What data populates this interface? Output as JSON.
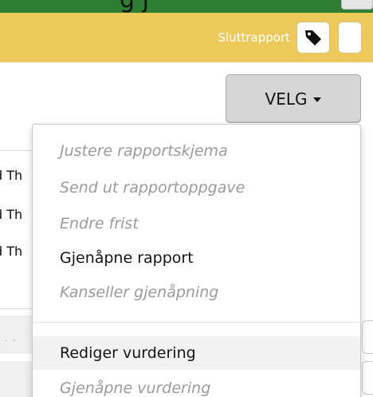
{
  "banner": {
    "text": "g          j"
  },
  "status_bar": {
    "label": "Sluttrapport",
    "tag_icon": "tag-icon"
  },
  "action_button": {
    "label": "VELG"
  },
  "background_rows": [
    "d Th",
    "d Th",
    "d Th"
  ],
  "background_dots": ". .",
  "menu": {
    "items": [
      {
        "label": "Justere rapportskjema",
        "enabled": false
      },
      {
        "label": "Send ut rapportoppgave",
        "enabled": false
      },
      {
        "label": "Endre frist",
        "enabled": false
      },
      {
        "label": "Gjenåpne rapport",
        "enabled": true
      },
      {
        "label": "Kanseller gjenåpning",
        "enabled": false
      },
      {
        "label": "Rediger vurdering",
        "enabled": true
      },
      {
        "label": "Gjenåpne vurdering",
        "enabled": false
      }
    ]
  },
  "colors": {
    "status_bar": "#edc95c",
    "banner": "#2e7d32",
    "disabled_text": "#9a9a9a"
  }
}
